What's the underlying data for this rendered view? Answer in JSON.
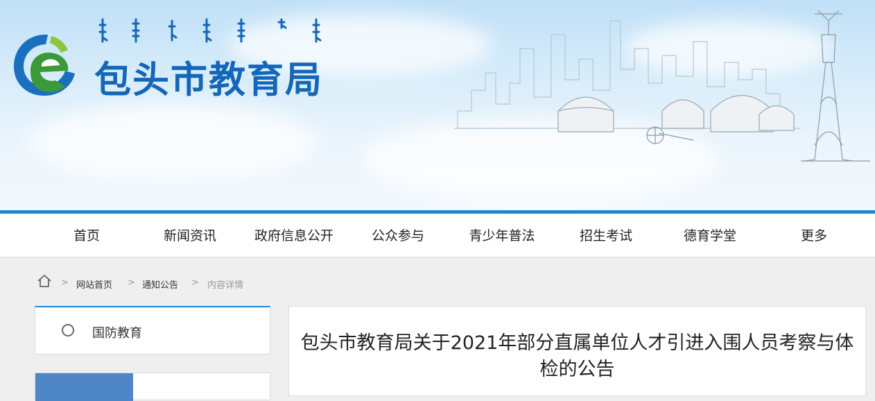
{
  "header": {
    "site_title": "包头市教育局",
    "mongolian_title_icon": "mongolian-script-title-icon",
    "logo_icon": "baotou-education-logo-icon",
    "skyline_icon": "city-skyline-yurts-icon",
    "monument_icon": "monument-tower-icon",
    "colors": {
      "title": "#1466b8",
      "accent_line": "#1d86d6",
      "logo_green": "#3a9a3a",
      "logo_blue": "#1b6fc0"
    }
  },
  "nav": {
    "items": [
      {
        "label": "首页"
      },
      {
        "label": "新闻资讯"
      },
      {
        "label": "政府信息公开"
      },
      {
        "label": "公众参与"
      },
      {
        "label": "青少年普法"
      },
      {
        "label": "招生考试"
      },
      {
        "label": "德育学堂"
      },
      {
        "label": "更多"
      }
    ]
  },
  "breadcrumb": {
    "home_icon": "home-icon",
    "separator": ">",
    "items": [
      "网站首页",
      "通知公告",
      "内容详情"
    ]
  },
  "sidebar": {
    "item_label": "国防教育",
    "radio_icon": "radio-circle-icon"
  },
  "article": {
    "title": "包头市教育局关于2021年部分直属单位人才引进入围人员考察与体检的公告"
  }
}
